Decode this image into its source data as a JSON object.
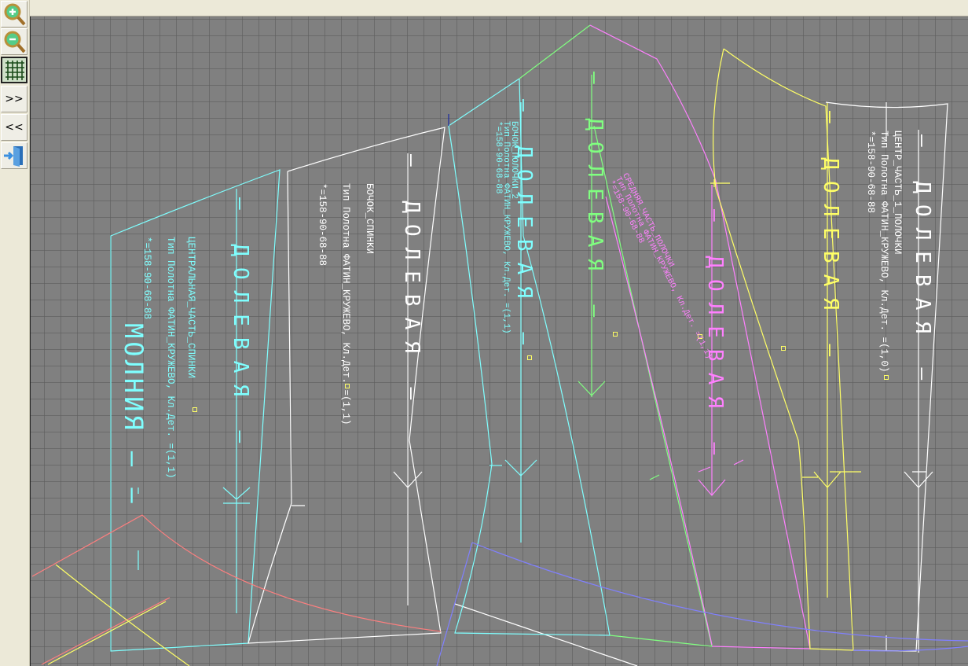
{
  "toolbar": {
    "buttons": [
      {
        "name": "zoom-in-button",
        "icon": "zoom-in-icon"
      },
      {
        "name": "zoom-out-button",
        "icon": "zoom-out-icon"
      },
      {
        "name": "grid-toggle-button",
        "icon": "grid-icon",
        "active": true
      },
      {
        "name": "next-button",
        "label": ">>"
      },
      {
        "name": "prev-button",
        "label": "<<"
      },
      {
        "name": "exit-button",
        "icon": "exit-door-icon"
      }
    ]
  },
  "colors": {
    "canvas": "#808080",
    "grid": "#5c5c5c",
    "cyan": "#7fffff",
    "white": "#ffffff",
    "green": "#80ff80",
    "magenta": "#ff80ff",
    "yellow": "#ffff66",
    "red": "#ff7f7f",
    "blue": "#8080ff"
  },
  "pieces": [
    {
      "title": "ЦЕНТРАЛЬНАЯ_ЧАСТЬ_СПИНКИ",
      "fabric": "Тип Полотна ФАТИН_КРУЖЕВО, Кл.Дет. =(1,1)",
      "size": "*=158-90-68-88",
      "color": "#7fffff"
    },
    {
      "title": "БОЧОК_СПИНКИ",
      "fabric": "Тип Полотна ФАТИН_КРУЖЕВО, Кл.Дет. =(1,1)",
      "size": "*=158-90-68-88",
      "color": "#ffffff"
    },
    {
      "title": "БОЧОК_ПОЛОЧКИ_2",
      "fabric": "Тип Полотна ФАТИН_КРУЖЕВО, Кл.Дет. =(1,1)",
      "size": "*=158-90-68-88",
      "color": "#7fffff"
    },
    {
      "title": "СРЕДНЯЯ_ЧАСТЬ_ПОЛОЧКИ",
      "fabric": "Тип Полотна ФАТИН_КРУЖЕВО, Кл.Дет. =(1,1)",
      "size": "*=158-90-68-88",
      "color": "#ff80ff"
    },
    {
      "title": "ЦЕНТР_ЧАСТЬ_1_ПОЛОЧКИ",
      "fabric": "Тип Полотна ФАТИН_КРУЖЕВО, Кл.Дет. =(1,0)",
      "size": "*=158-90-68-88",
      "color": "#ffffff"
    }
  ],
  "grain_label": "— ДОЛЕВАЯ —",
  "zipper_label": "МОЛНИЯ — —"
}
